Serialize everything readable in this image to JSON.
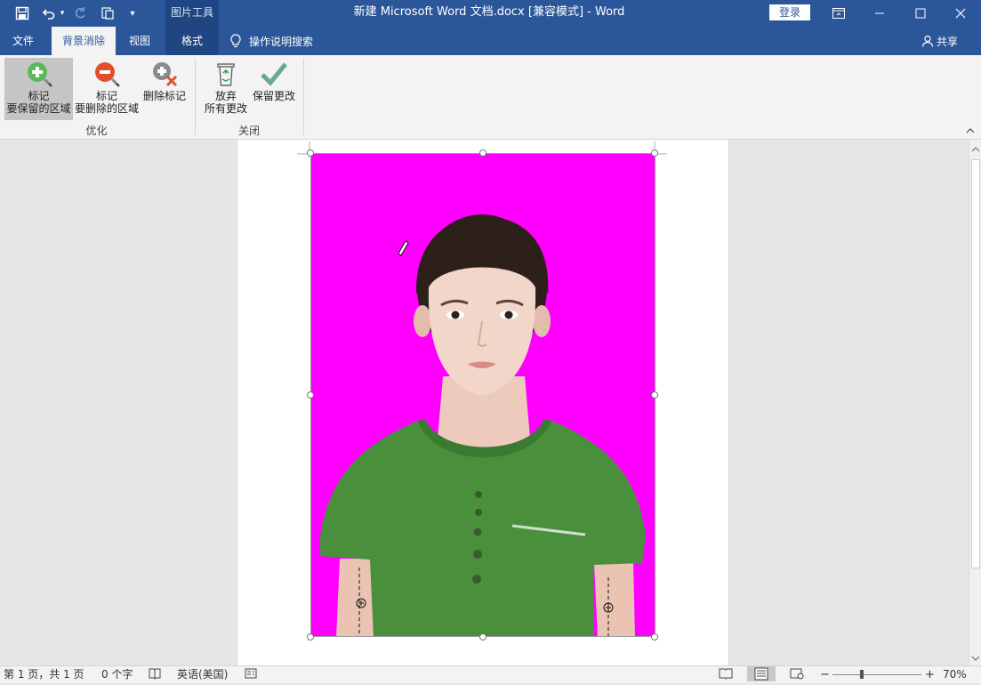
{
  "titlebar": {
    "context_header": "图片工具",
    "title": "新建 Microsoft Word 文档.docx [兼容模式]  -  Word",
    "login": "登录",
    "icons": [
      "save-icon",
      "undo-icon",
      "redo-icon",
      "touch-mode-icon",
      "customize-qat-icon",
      "ribbon-display-icon",
      "minimize-icon",
      "maximize-icon",
      "close-icon"
    ]
  },
  "tabs": {
    "file": "文件",
    "background_removal": "背景消除",
    "view": "视图",
    "format": "格式",
    "tell_me": "操作说明搜索",
    "share": "共享"
  },
  "ribbon": {
    "mark_keep_line1": "标记",
    "mark_keep_line2": "要保留的区域",
    "mark_remove_line1": "标记",
    "mark_remove_line2": "要删除的区域",
    "delete_mark": "删除标记",
    "group_refine": "优化",
    "discard_line1": "放弃",
    "discard_line2": "所有更改",
    "keep_changes": "保留更改",
    "group_close": "关闭"
  },
  "statusbar": {
    "page": "第 1 页，共 1 页",
    "words": "0 个字",
    "language": "英语(美国)",
    "zoom": "70%",
    "zoom_minus": "−",
    "zoom_plus": "+"
  },
  "colors": {
    "accent": "#2b579a",
    "removal_magenta": "#ff00ff",
    "keep_green": "#5cb85c",
    "remove_red": "#e0502d"
  }
}
